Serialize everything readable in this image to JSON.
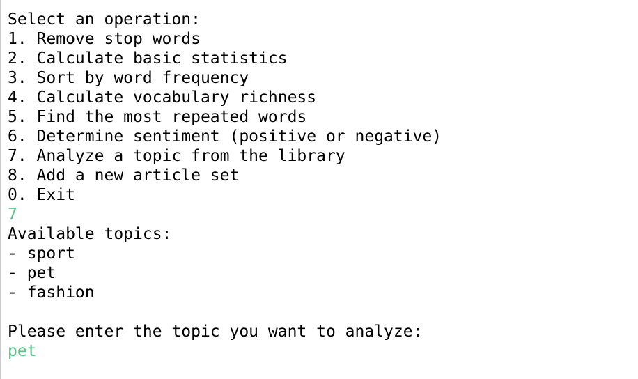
{
  "console": {
    "menu_prompt": "Select an operation:",
    "menu_items": [
      "1. Remove stop words",
      "2. Calculate basic statistics",
      "3. Sort by word frequency",
      "4. Calculate vocabulary richness",
      "5. Find the most repeated words",
      "6. Determine sentiment (positive or negative)",
      "7. Analyze a topic from the library",
      "8. Add a new article set",
      "0. Exit"
    ],
    "user_choice": "7",
    "topics_header": "Available topics:",
    "topics": [
      "- sport",
      "- pet",
      "- fashion"
    ],
    "topic_prompt": "Please enter the topic you want to analyze:",
    "user_topic": "pet"
  },
  "colors": {
    "text": "#000000",
    "user_input": "#5cbf86",
    "background": "#ffffff"
  }
}
